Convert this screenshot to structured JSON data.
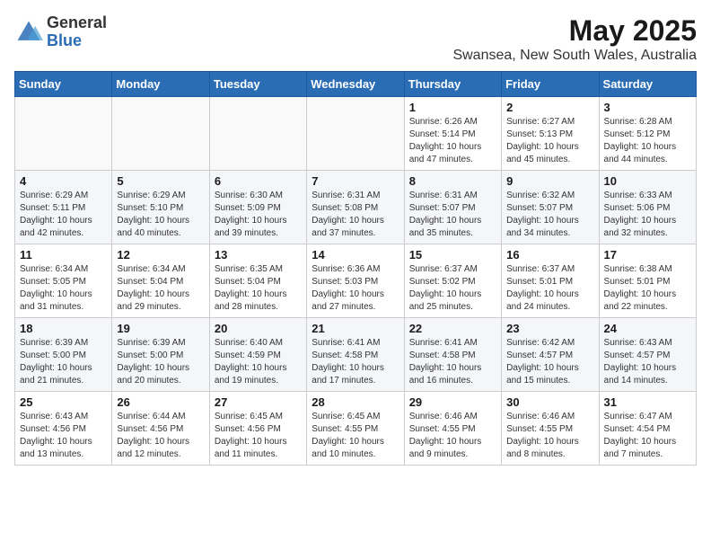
{
  "header": {
    "logo_general": "General",
    "logo_blue": "Blue",
    "title": "May 2025",
    "subtitle": "Swansea, New South Wales, Australia"
  },
  "weekdays": [
    "Sunday",
    "Monday",
    "Tuesday",
    "Wednesday",
    "Thursday",
    "Friday",
    "Saturday"
  ],
  "weeks": [
    [
      {
        "day": "",
        "info": ""
      },
      {
        "day": "",
        "info": ""
      },
      {
        "day": "",
        "info": ""
      },
      {
        "day": "",
        "info": ""
      },
      {
        "day": "1",
        "info": "Sunrise: 6:26 AM\nSunset: 5:14 PM\nDaylight: 10 hours\nand 47 minutes."
      },
      {
        "day": "2",
        "info": "Sunrise: 6:27 AM\nSunset: 5:13 PM\nDaylight: 10 hours\nand 45 minutes."
      },
      {
        "day": "3",
        "info": "Sunrise: 6:28 AM\nSunset: 5:12 PM\nDaylight: 10 hours\nand 44 minutes."
      }
    ],
    [
      {
        "day": "4",
        "info": "Sunrise: 6:29 AM\nSunset: 5:11 PM\nDaylight: 10 hours\nand 42 minutes."
      },
      {
        "day": "5",
        "info": "Sunrise: 6:29 AM\nSunset: 5:10 PM\nDaylight: 10 hours\nand 40 minutes."
      },
      {
        "day": "6",
        "info": "Sunrise: 6:30 AM\nSunset: 5:09 PM\nDaylight: 10 hours\nand 39 minutes."
      },
      {
        "day": "7",
        "info": "Sunrise: 6:31 AM\nSunset: 5:08 PM\nDaylight: 10 hours\nand 37 minutes."
      },
      {
        "day": "8",
        "info": "Sunrise: 6:31 AM\nSunset: 5:07 PM\nDaylight: 10 hours\nand 35 minutes."
      },
      {
        "day": "9",
        "info": "Sunrise: 6:32 AM\nSunset: 5:07 PM\nDaylight: 10 hours\nand 34 minutes."
      },
      {
        "day": "10",
        "info": "Sunrise: 6:33 AM\nSunset: 5:06 PM\nDaylight: 10 hours\nand 32 minutes."
      }
    ],
    [
      {
        "day": "11",
        "info": "Sunrise: 6:34 AM\nSunset: 5:05 PM\nDaylight: 10 hours\nand 31 minutes."
      },
      {
        "day": "12",
        "info": "Sunrise: 6:34 AM\nSunset: 5:04 PM\nDaylight: 10 hours\nand 29 minutes."
      },
      {
        "day": "13",
        "info": "Sunrise: 6:35 AM\nSunset: 5:04 PM\nDaylight: 10 hours\nand 28 minutes."
      },
      {
        "day": "14",
        "info": "Sunrise: 6:36 AM\nSunset: 5:03 PM\nDaylight: 10 hours\nand 27 minutes."
      },
      {
        "day": "15",
        "info": "Sunrise: 6:37 AM\nSunset: 5:02 PM\nDaylight: 10 hours\nand 25 minutes."
      },
      {
        "day": "16",
        "info": "Sunrise: 6:37 AM\nSunset: 5:01 PM\nDaylight: 10 hours\nand 24 minutes."
      },
      {
        "day": "17",
        "info": "Sunrise: 6:38 AM\nSunset: 5:01 PM\nDaylight: 10 hours\nand 22 minutes."
      }
    ],
    [
      {
        "day": "18",
        "info": "Sunrise: 6:39 AM\nSunset: 5:00 PM\nDaylight: 10 hours\nand 21 minutes."
      },
      {
        "day": "19",
        "info": "Sunrise: 6:39 AM\nSunset: 5:00 PM\nDaylight: 10 hours\nand 20 minutes."
      },
      {
        "day": "20",
        "info": "Sunrise: 6:40 AM\nSunset: 4:59 PM\nDaylight: 10 hours\nand 19 minutes."
      },
      {
        "day": "21",
        "info": "Sunrise: 6:41 AM\nSunset: 4:58 PM\nDaylight: 10 hours\nand 17 minutes."
      },
      {
        "day": "22",
        "info": "Sunrise: 6:41 AM\nSunset: 4:58 PM\nDaylight: 10 hours\nand 16 minutes."
      },
      {
        "day": "23",
        "info": "Sunrise: 6:42 AM\nSunset: 4:57 PM\nDaylight: 10 hours\nand 15 minutes."
      },
      {
        "day": "24",
        "info": "Sunrise: 6:43 AM\nSunset: 4:57 PM\nDaylight: 10 hours\nand 14 minutes."
      }
    ],
    [
      {
        "day": "25",
        "info": "Sunrise: 6:43 AM\nSunset: 4:56 PM\nDaylight: 10 hours\nand 13 minutes."
      },
      {
        "day": "26",
        "info": "Sunrise: 6:44 AM\nSunset: 4:56 PM\nDaylight: 10 hours\nand 12 minutes."
      },
      {
        "day": "27",
        "info": "Sunrise: 6:45 AM\nSunset: 4:56 PM\nDaylight: 10 hours\nand 11 minutes."
      },
      {
        "day": "28",
        "info": "Sunrise: 6:45 AM\nSunset: 4:55 PM\nDaylight: 10 hours\nand 10 minutes."
      },
      {
        "day": "29",
        "info": "Sunrise: 6:46 AM\nSunset: 4:55 PM\nDaylight: 10 hours\nand 9 minutes."
      },
      {
        "day": "30",
        "info": "Sunrise: 6:46 AM\nSunset: 4:55 PM\nDaylight: 10 hours\nand 8 minutes."
      },
      {
        "day": "31",
        "info": "Sunrise: 6:47 AM\nSunset: 4:54 PM\nDaylight: 10 hours\nand 7 minutes."
      }
    ]
  ]
}
